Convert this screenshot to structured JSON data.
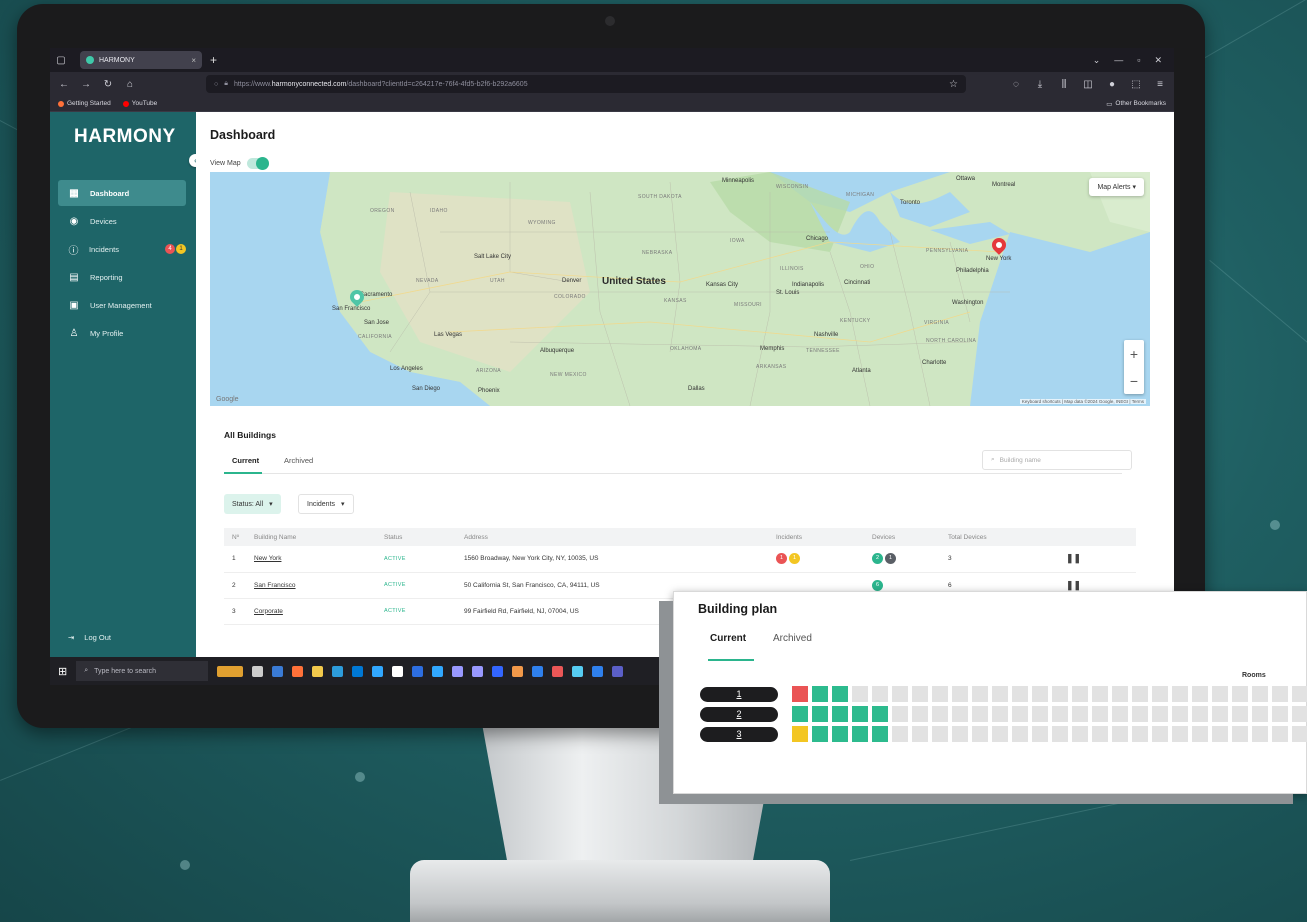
{
  "colors": {
    "brand": "#1e6568",
    "accent": "#2bb58d",
    "alert_red": "#ea5455",
    "alert_yellow": "#f3c623"
  },
  "browser": {
    "tab_title": "HARMONY",
    "url_prefix": "https://www.",
    "url_domain": "harmonyconnected.com",
    "url_path": "/dashboard?clientId=c264217e-76f4-4fd5-b2f6-b292a6605",
    "bookmarks": [
      "Getting Started",
      "YouTube"
    ],
    "other_bookmarks": "Other Bookmarks"
  },
  "sidebar": {
    "logo": "HARMONY",
    "items": [
      {
        "label": "Dashboard",
        "icon": "grid-icon"
      },
      {
        "label": "Devices",
        "icon": "device-icon"
      },
      {
        "label": "Incidents",
        "icon": "info-icon",
        "badges": [
          "4",
          "1"
        ]
      },
      {
        "label": "Reporting",
        "icon": "report-icon"
      },
      {
        "label": "User Management",
        "icon": "users-icon"
      },
      {
        "label": "My Profile",
        "icon": "person-icon"
      }
    ],
    "logout": "Log Out"
  },
  "dashboard": {
    "title": "Dashboard",
    "view_map": "View Map",
    "map": {
      "alerts_button": "Map Alerts",
      "google": "Google",
      "attribution": "Keyboard shortcuts | Map data ©2024 Google, INEGI | Terms",
      "labels": {
        "country": "United States",
        "minneapolis": "Minneapolis",
        "chicago": "Chicago",
        "toronto": "Toronto",
        "montreal": "Montreal",
        "ottawa": "Ottawa",
        "newyork": "New York",
        "philadelphia": "Philadelphia",
        "washington": "Washington",
        "denver": "Denver",
        "kansascity": "Kansas City",
        "stlouis": "St. Louis",
        "indianapolis": "Indianapolis",
        "cincinnati": "Cincinnati",
        "nashville": "Nashville",
        "memphis": "Memphis",
        "atlanta": "Atlanta",
        "charlotte": "Charlotte",
        "dallas": "Dallas",
        "albuquerque": "Albuquerque",
        "lasvegas": "Las Vegas",
        "losangeles": "Los Angeles",
        "sandiego": "San Diego",
        "phoenix": "Phoenix",
        "sanfrancisco": "San Francisco",
        "sanjose": "San Jose",
        "sacramento": "Sacramento",
        "saltlakecity": "Salt Lake City",
        "nebraska": "NEBRASKA",
        "kansas": "KANSAS",
        "iowa": "IOWA",
        "illinois": "ILLINOIS",
        "ohio": "OHIO",
        "missouri": "MISSOURI",
        "colorado": "COLORADO",
        "utah": "UTAH",
        "nevada": "NEVADA",
        "california": "CALIFORNIA",
        "arizona": "ARIZONA",
        "newmexico": "NEW MEXICO",
        "oklahoma": "OKLAHOMA",
        "wyoming": "WYOMING",
        "pennsylvania": "PENNSYLVANIA",
        "kentucky": "KENTUCKY",
        "tennessee": "TENNESSEE",
        "virginia": "VIRGINIA",
        "northcarolina": "NORTH CAROLINA",
        "idaho": "IDAHO",
        "oregon": "OREGON",
        "southdakota": "SOUTH DAKOTA",
        "wisconsin": "WISCONSIN",
        "michigan": "MICHIGAN",
        "arkansas": "ARKANSAS"
      }
    }
  },
  "buildings": {
    "title": "All Buildings",
    "tabs": [
      "Current",
      "Archived"
    ],
    "search_placeholder": "Building name",
    "filters": {
      "status": "Status: All",
      "incidents": "Incidents"
    },
    "columns": [
      "Nº",
      "Building Name",
      "Status",
      "Address",
      "Incidents",
      "Devices",
      "Total Devices",
      ""
    ],
    "rows": [
      {
        "n": "1",
        "name": "New York",
        "status": "ACTIVE",
        "address": "1560 Broadway, New York City, NY, 10035, US",
        "incidents": [
          {
            "c": "#ea5455",
            "v": "1"
          },
          {
            "c": "#f3c623",
            "v": "1"
          }
        ],
        "devices": [
          {
            "c": "#2bb58d",
            "v": "2"
          },
          {
            "c": "#5a5f66",
            "v": "1"
          }
        ],
        "total": "3"
      },
      {
        "n": "2",
        "name": "San Francisco",
        "status": "ACTIVE",
        "address": "50 California St, San Francisco, CA, 94111, US",
        "incidents": [],
        "devices": [
          {
            "c": "#2bb58d",
            "v": "6"
          }
        ],
        "total": "6"
      },
      {
        "n": "3",
        "name": "Corporate",
        "status": "ACTIVE",
        "address": "99 Fairfield Rd, Fairfield, NJ, 07004, US",
        "incidents": [],
        "devices": [],
        "total": ""
      }
    ]
  },
  "taskbar": {
    "search_placeholder": "Type here to search"
  },
  "building_plan": {
    "title": "Building plan",
    "tabs": [
      "Current",
      "Archived"
    ],
    "rooms_label": "Rooms",
    "floors": [
      {
        "label": "1",
        "cells": [
          "r",
          "g",
          "g"
        ]
      },
      {
        "label": "2",
        "cells": [
          "g",
          "g",
          "g",
          "g",
          "g"
        ]
      },
      {
        "label": "3",
        "cells": [
          "y",
          "g",
          "g",
          "g",
          "g"
        ]
      }
    ]
  }
}
